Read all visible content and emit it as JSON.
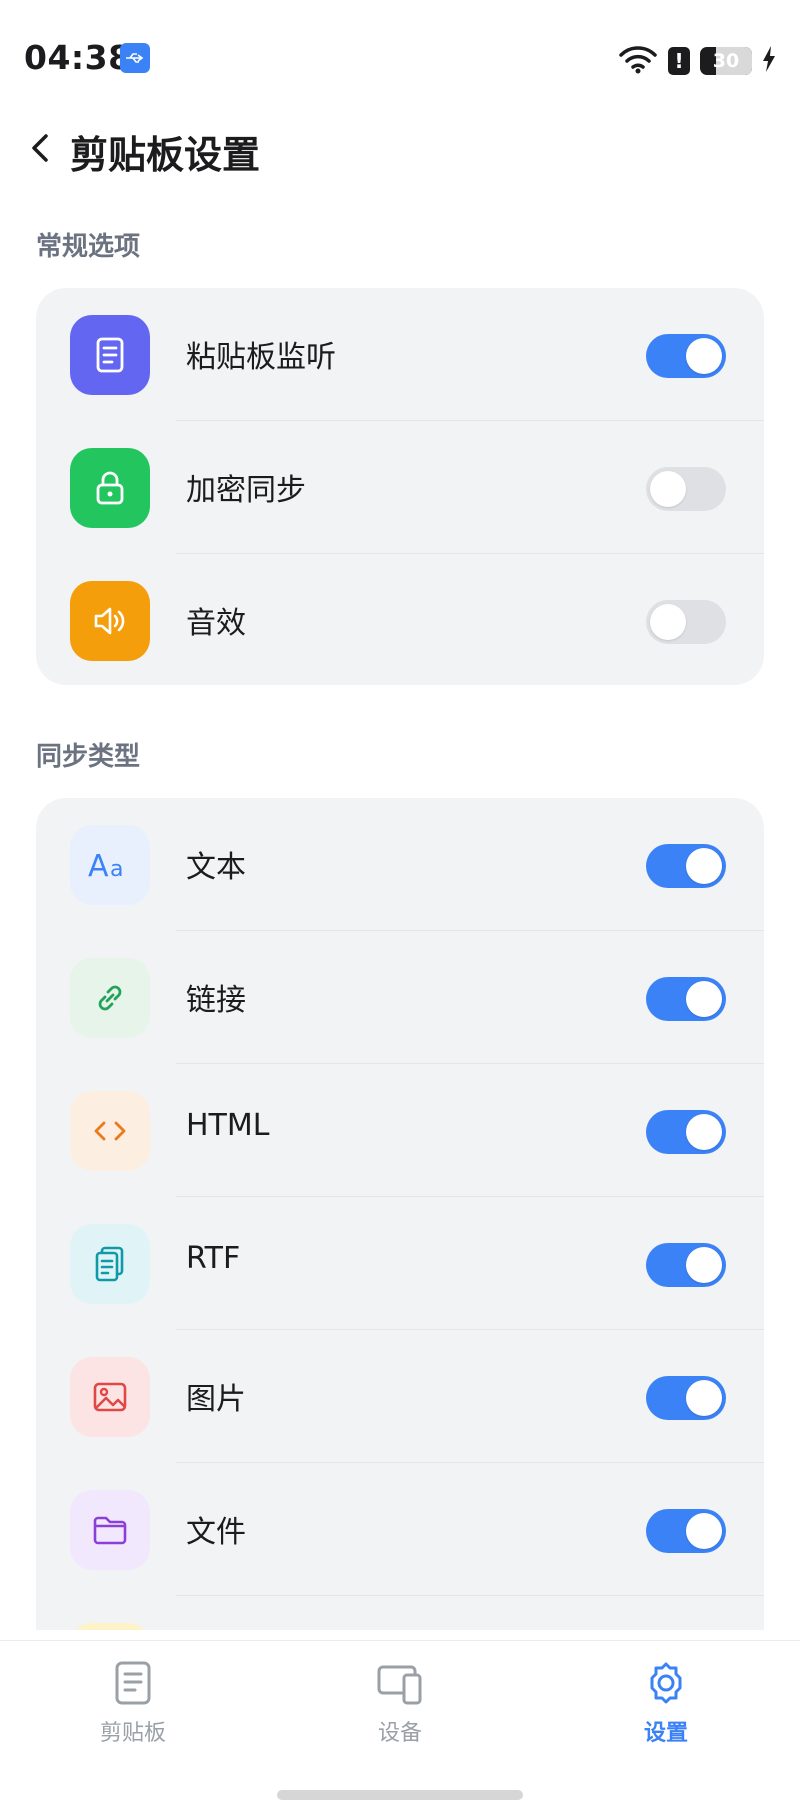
{
  "status_bar": {
    "time": "04:38",
    "battery": "30"
  },
  "header": {
    "title": "剪贴板设置"
  },
  "sections": [
    {
      "title": "常规选项",
      "items": [
        {
          "label": "粘贴板监听",
          "icon": "clipboard-icon",
          "enabled": true,
          "icon_bg": "#6366f1"
        },
        {
          "label": "加密同步",
          "icon": "lock-icon",
          "enabled": false,
          "icon_bg": "#22c55e"
        },
        {
          "label": "音效",
          "icon": "speaker-icon",
          "enabled": false,
          "icon_bg": "#f59e0b"
        }
      ]
    },
    {
      "title": "同步类型",
      "items": [
        {
          "label": "文本",
          "icon": "text-icon",
          "enabled": true,
          "icon_bg": "#e8f0fe"
        },
        {
          "label": "链接",
          "icon": "link-icon",
          "enabled": true,
          "icon_bg": "#e6f4ea"
        },
        {
          "label": "HTML",
          "icon": "code-icon",
          "enabled": true,
          "icon_bg": "#fdeee2"
        },
        {
          "label": "RTF",
          "icon": "document-icon",
          "enabled": true,
          "icon_bg": "#e0f4f7"
        },
        {
          "label": "图片",
          "icon": "image-icon",
          "enabled": true,
          "icon_bg": "#fde4e4"
        },
        {
          "label": "文件",
          "icon": "folder-icon",
          "enabled": true,
          "icon_bg": "#f1e8fd"
        }
      ]
    }
  ],
  "bottom_nav": [
    {
      "label": "剪贴板",
      "icon": "clipboard-icon",
      "active": false
    },
    {
      "label": "设备",
      "icon": "devices-icon",
      "active": false
    },
    {
      "label": "设置",
      "icon": "gear-icon",
      "active": true
    }
  ],
  "colors": {
    "accent": "#3b82f6",
    "toggle_off": "#dfe0e3",
    "card_bg": "#f2f3f5"
  }
}
